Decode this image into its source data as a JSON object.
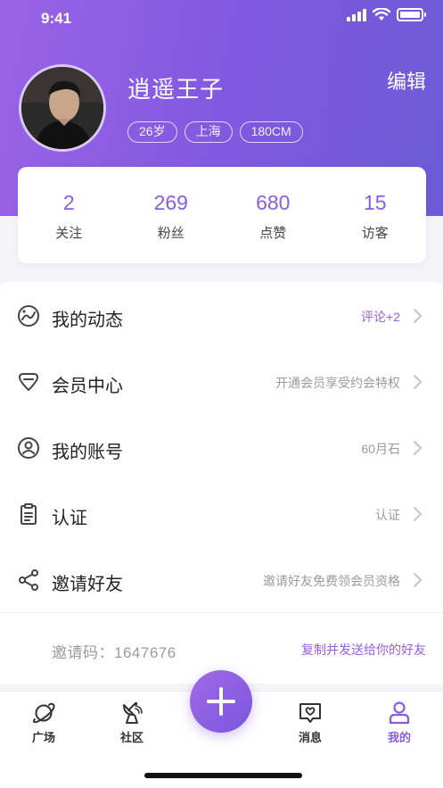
{
  "status_bar": {
    "time": "9:41"
  },
  "profile": {
    "name": "逍遥王子",
    "edit_label": "编辑",
    "tags": [
      "26岁",
      "上海",
      "180CM"
    ]
  },
  "stats": [
    {
      "value": "2",
      "label": "关注"
    },
    {
      "value": "269",
      "label": "粉丝"
    },
    {
      "value": "680",
      "label": "点赞"
    },
    {
      "value": "15",
      "label": "访客"
    }
  ],
  "menu": [
    {
      "label": "我的动态",
      "value": "评论+2",
      "icon": "globe-icon"
    },
    {
      "label": "会员中心",
      "value": "开通会员享受约会特权",
      "icon": "diamond-icon"
    },
    {
      "label": "我的账号",
      "value": "60月石",
      "icon": "user-circle-icon"
    },
    {
      "label": "认证",
      "value": "认证",
      "icon": "clipboard-icon"
    },
    {
      "label": "邀请好友",
      "value": "邀请好友免费领会员资格",
      "icon": "share-icon"
    }
  ],
  "invite": {
    "code_label": "邀请码：1647676",
    "link_label": "复制并发送给你的好友"
  },
  "tabbar": [
    {
      "label": "广场",
      "icon": "planet-icon"
    },
    {
      "label": "社区",
      "icon": "satellite-dish-icon"
    },
    {
      "label": "消息",
      "icon": "message-heart-icon"
    },
    {
      "label": "我的",
      "icon": "person-icon"
    }
  ],
  "colors": {
    "accent": "#8a5ce0",
    "header_start": "#9a63e6",
    "header_end": "#6b5bd6"
  }
}
